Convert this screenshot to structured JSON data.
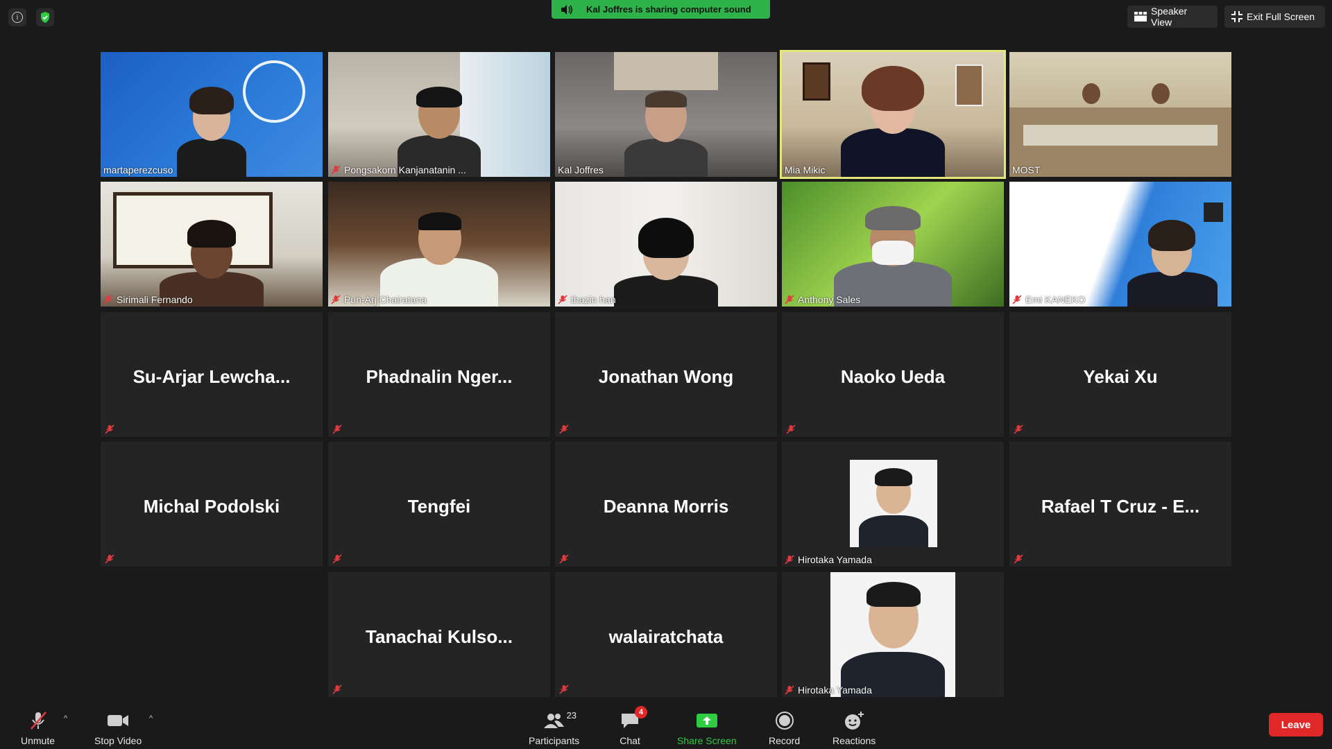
{
  "banner": {
    "text": "Kal Joffres is sharing computer sound"
  },
  "view_buttons": {
    "speaker_view": "Speaker View",
    "exit_full_screen": "Exit Full Screen"
  },
  "tiles": [
    {
      "name": "martaperezcuso"
    },
    {
      "name": "Pongsakorn Kanjanatanin ..."
    },
    {
      "name": "Kal Joffres"
    },
    {
      "name": "Mia Mikic"
    },
    {
      "name": "MOST"
    },
    {
      "name": "Sirimali Fernando"
    },
    {
      "name": "Pun-Arj Chairatana"
    },
    {
      "name": "thazin han"
    },
    {
      "name": "Anthony Sales"
    },
    {
      "name": "Emi KANEKO"
    },
    {
      "name": "Su-Arjar  Lewcha..."
    },
    {
      "name": "Phadnalin  Nger..."
    },
    {
      "name": "Jonathan Wong"
    },
    {
      "name": "Naoko Ueda"
    },
    {
      "name": "Yekai Xu"
    },
    {
      "name": "Michal Podolski"
    },
    {
      "name": "Tengfei"
    },
    {
      "name": "Deanna Morris"
    },
    {
      "name": "Hirotaka Yamada"
    },
    {
      "name": "Rafael T Cruz - E..."
    },
    {
      "name": "Tanachai  Kulso..."
    },
    {
      "name": "walairatchata"
    },
    {
      "name": "Hirotaka Yamada"
    }
  ],
  "toolbar": {
    "unmute": "Unmute",
    "stop_video": "Stop Video",
    "participants": "Participants",
    "participants_count": "23",
    "chat": "Chat",
    "chat_badge": "4",
    "share_screen": "Share Screen",
    "record": "Record",
    "reactions": "Reactions",
    "leave": "Leave"
  },
  "colors": {
    "share_green": "#2eb34a",
    "active_speaker": "#e3e87a",
    "leave_red": "#e02828"
  }
}
